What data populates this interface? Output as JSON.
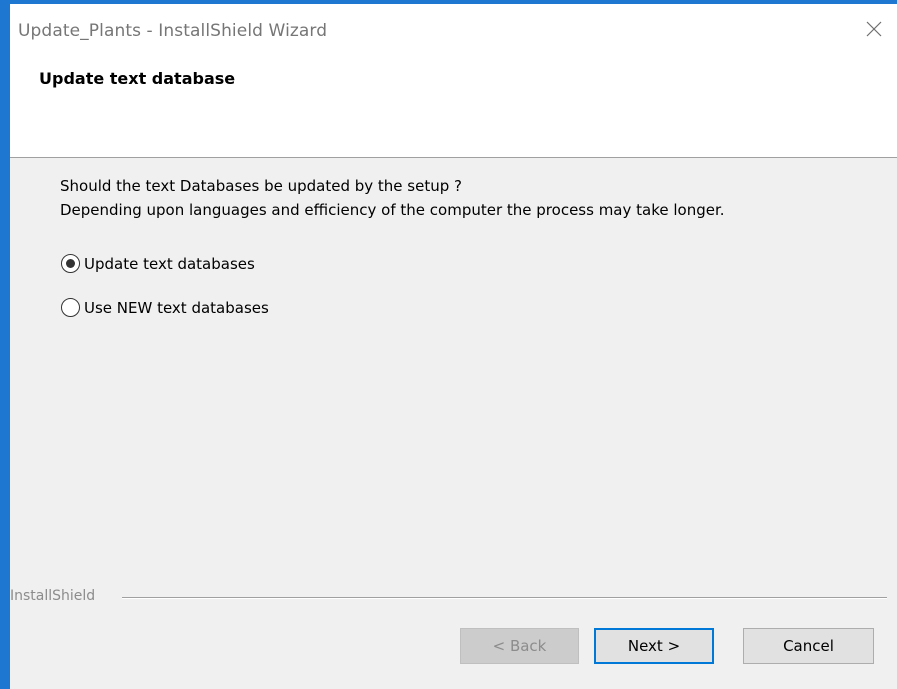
{
  "window": {
    "title": "Update_Plants - InstallShield Wizard"
  },
  "header": {
    "title": "Update text database"
  },
  "description": {
    "line1": "Should the text Databases be updated by the setup ?",
    "line2": "Depending upon languages and efficiency of the computer the process may take longer."
  },
  "options": [
    {
      "label": "Update text databases",
      "selected": true
    },
    {
      "label": "Use NEW text databases",
      "selected": false
    }
  ],
  "branding": {
    "label": "InstallShield"
  },
  "buttons": {
    "back_label": "< Back",
    "next_label": "Next >",
    "cancel_label": "Cancel"
  },
  "colors": {
    "accent": "#1e78d2",
    "default_button_border": "#0078d7",
    "content_bg": "#f0f0f0"
  },
  "icons": {
    "close": "close-icon"
  }
}
